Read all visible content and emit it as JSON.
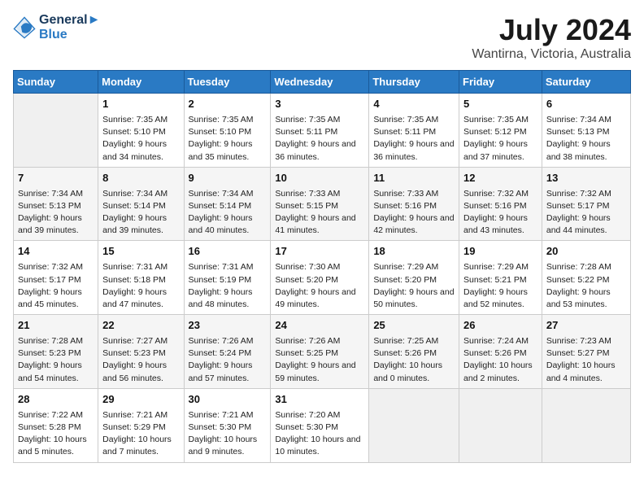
{
  "header": {
    "logo_line1": "General",
    "logo_line2": "Blue",
    "title": "July 2024",
    "subtitle": "Wantirna, Victoria, Australia"
  },
  "weekdays": [
    "Sunday",
    "Monday",
    "Tuesday",
    "Wednesday",
    "Thursday",
    "Friday",
    "Saturday"
  ],
  "weeks": [
    [
      {
        "day": "",
        "sunrise": "",
        "sunset": "",
        "daylight": ""
      },
      {
        "day": "1",
        "sunrise": "Sunrise: 7:35 AM",
        "sunset": "Sunset: 5:10 PM",
        "daylight": "Daylight: 9 hours and 34 minutes."
      },
      {
        "day": "2",
        "sunrise": "Sunrise: 7:35 AM",
        "sunset": "Sunset: 5:10 PM",
        "daylight": "Daylight: 9 hours and 35 minutes."
      },
      {
        "day": "3",
        "sunrise": "Sunrise: 7:35 AM",
        "sunset": "Sunset: 5:11 PM",
        "daylight": "Daylight: 9 hours and 36 minutes."
      },
      {
        "day": "4",
        "sunrise": "Sunrise: 7:35 AM",
        "sunset": "Sunset: 5:11 PM",
        "daylight": "Daylight: 9 hours and 36 minutes."
      },
      {
        "day": "5",
        "sunrise": "Sunrise: 7:35 AM",
        "sunset": "Sunset: 5:12 PM",
        "daylight": "Daylight: 9 hours and 37 minutes."
      },
      {
        "day": "6",
        "sunrise": "Sunrise: 7:34 AM",
        "sunset": "Sunset: 5:13 PM",
        "daylight": "Daylight: 9 hours and 38 minutes."
      }
    ],
    [
      {
        "day": "7",
        "sunrise": "Sunrise: 7:34 AM",
        "sunset": "Sunset: 5:13 PM",
        "daylight": "Daylight: 9 hours and 39 minutes."
      },
      {
        "day": "8",
        "sunrise": "Sunrise: 7:34 AM",
        "sunset": "Sunset: 5:14 PM",
        "daylight": "Daylight: 9 hours and 39 minutes."
      },
      {
        "day": "9",
        "sunrise": "Sunrise: 7:34 AM",
        "sunset": "Sunset: 5:14 PM",
        "daylight": "Daylight: 9 hours and 40 minutes."
      },
      {
        "day": "10",
        "sunrise": "Sunrise: 7:33 AM",
        "sunset": "Sunset: 5:15 PM",
        "daylight": "Daylight: 9 hours and 41 minutes."
      },
      {
        "day": "11",
        "sunrise": "Sunrise: 7:33 AM",
        "sunset": "Sunset: 5:16 PM",
        "daylight": "Daylight: 9 hours and 42 minutes."
      },
      {
        "day": "12",
        "sunrise": "Sunrise: 7:32 AM",
        "sunset": "Sunset: 5:16 PM",
        "daylight": "Daylight: 9 hours and 43 minutes."
      },
      {
        "day": "13",
        "sunrise": "Sunrise: 7:32 AM",
        "sunset": "Sunset: 5:17 PM",
        "daylight": "Daylight: 9 hours and 44 minutes."
      }
    ],
    [
      {
        "day": "14",
        "sunrise": "Sunrise: 7:32 AM",
        "sunset": "Sunset: 5:17 PM",
        "daylight": "Daylight: 9 hours and 45 minutes."
      },
      {
        "day": "15",
        "sunrise": "Sunrise: 7:31 AM",
        "sunset": "Sunset: 5:18 PM",
        "daylight": "Daylight: 9 hours and 47 minutes."
      },
      {
        "day": "16",
        "sunrise": "Sunrise: 7:31 AM",
        "sunset": "Sunset: 5:19 PM",
        "daylight": "Daylight: 9 hours and 48 minutes."
      },
      {
        "day": "17",
        "sunrise": "Sunrise: 7:30 AM",
        "sunset": "Sunset: 5:20 PM",
        "daylight": "Daylight: 9 hours and 49 minutes."
      },
      {
        "day": "18",
        "sunrise": "Sunrise: 7:29 AM",
        "sunset": "Sunset: 5:20 PM",
        "daylight": "Daylight: 9 hours and 50 minutes."
      },
      {
        "day": "19",
        "sunrise": "Sunrise: 7:29 AM",
        "sunset": "Sunset: 5:21 PM",
        "daylight": "Daylight: 9 hours and 52 minutes."
      },
      {
        "day": "20",
        "sunrise": "Sunrise: 7:28 AM",
        "sunset": "Sunset: 5:22 PM",
        "daylight": "Daylight: 9 hours and 53 minutes."
      }
    ],
    [
      {
        "day": "21",
        "sunrise": "Sunrise: 7:28 AM",
        "sunset": "Sunset: 5:23 PM",
        "daylight": "Daylight: 9 hours and 54 minutes."
      },
      {
        "day": "22",
        "sunrise": "Sunrise: 7:27 AM",
        "sunset": "Sunset: 5:23 PM",
        "daylight": "Daylight: 9 hours and 56 minutes."
      },
      {
        "day": "23",
        "sunrise": "Sunrise: 7:26 AM",
        "sunset": "Sunset: 5:24 PM",
        "daylight": "Daylight: 9 hours and 57 minutes."
      },
      {
        "day": "24",
        "sunrise": "Sunrise: 7:26 AM",
        "sunset": "Sunset: 5:25 PM",
        "daylight": "Daylight: 9 hours and 59 minutes."
      },
      {
        "day": "25",
        "sunrise": "Sunrise: 7:25 AM",
        "sunset": "Sunset: 5:26 PM",
        "daylight": "Daylight: 10 hours and 0 minutes."
      },
      {
        "day": "26",
        "sunrise": "Sunrise: 7:24 AM",
        "sunset": "Sunset: 5:26 PM",
        "daylight": "Daylight: 10 hours and 2 minutes."
      },
      {
        "day": "27",
        "sunrise": "Sunrise: 7:23 AM",
        "sunset": "Sunset: 5:27 PM",
        "daylight": "Daylight: 10 hours and 4 minutes."
      }
    ],
    [
      {
        "day": "28",
        "sunrise": "Sunrise: 7:22 AM",
        "sunset": "Sunset: 5:28 PM",
        "daylight": "Daylight: 10 hours and 5 minutes."
      },
      {
        "day": "29",
        "sunrise": "Sunrise: 7:21 AM",
        "sunset": "Sunset: 5:29 PM",
        "daylight": "Daylight: 10 hours and 7 minutes."
      },
      {
        "day": "30",
        "sunrise": "Sunrise: 7:21 AM",
        "sunset": "Sunset: 5:30 PM",
        "daylight": "Daylight: 10 hours and 9 minutes."
      },
      {
        "day": "31",
        "sunrise": "Sunrise: 7:20 AM",
        "sunset": "Sunset: 5:30 PM",
        "daylight": "Daylight: 10 hours and 10 minutes."
      },
      {
        "day": "",
        "sunrise": "",
        "sunset": "",
        "daylight": ""
      },
      {
        "day": "",
        "sunrise": "",
        "sunset": "",
        "daylight": ""
      },
      {
        "day": "",
        "sunrise": "",
        "sunset": "",
        "daylight": ""
      }
    ]
  ]
}
